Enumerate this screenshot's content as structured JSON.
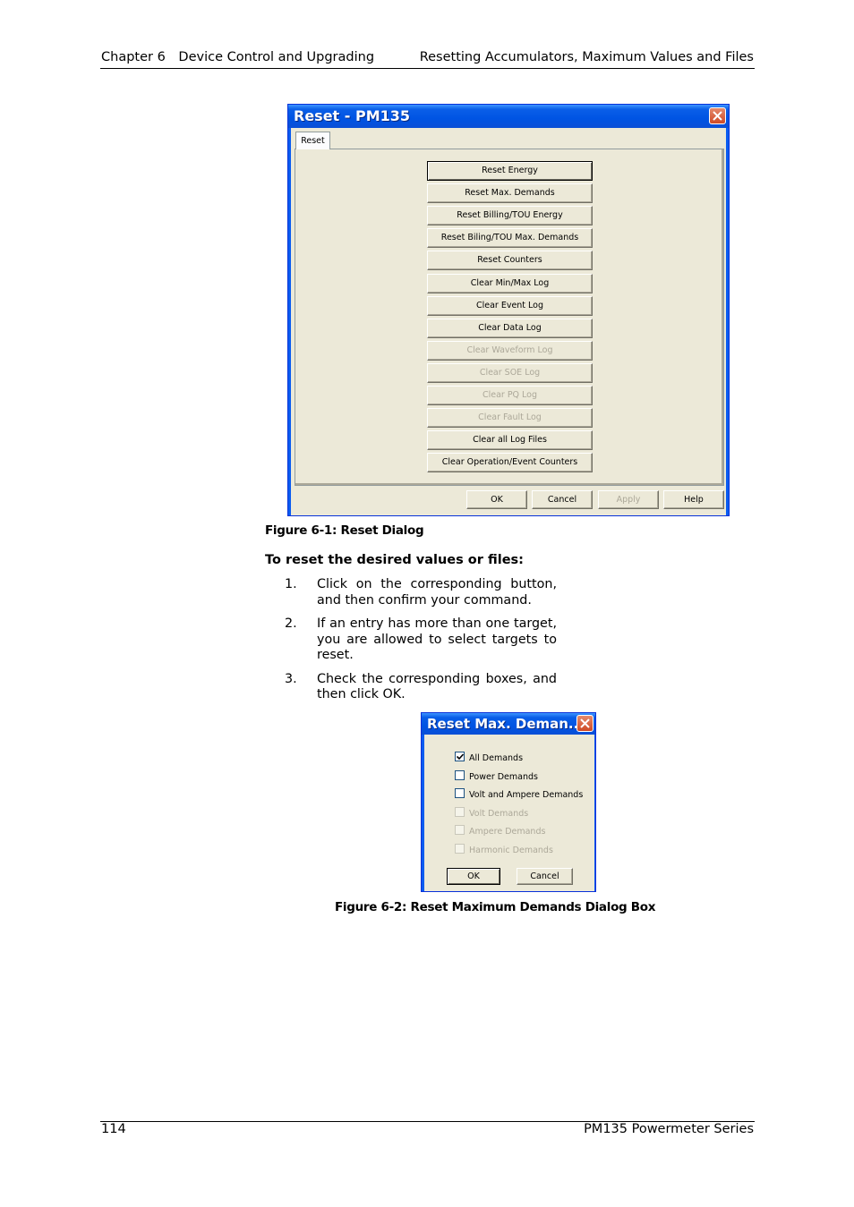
{
  "header": {
    "chapter": "Chapter 6",
    "chapter_title": "Device Control and Upgrading",
    "section_title": "Resetting Accumulators, Maximum Values and Files"
  },
  "figure1": {
    "window_title": "Reset - PM135",
    "tab_label": "Reset",
    "buttons": [
      {
        "label": "Reset Energy",
        "enabled": true,
        "default": true
      },
      {
        "label": "Reset Max. Demands",
        "enabled": true
      },
      {
        "label": "Reset Billing/TOU Energy",
        "enabled": true
      },
      {
        "label": "Reset Biling/TOU Max. Demands",
        "enabled": true
      },
      {
        "label": "Reset Counters",
        "enabled": true
      },
      {
        "label": "Clear Min/Max Log",
        "enabled": true
      },
      {
        "label": "Clear Event Log",
        "enabled": true
      },
      {
        "label": "Clear Data Log",
        "enabled": true
      },
      {
        "label": "Clear Waveform Log",
        "enabled": false
      },
      {
        "label": "Clear SOE Log",
        "enabled": false
      },
      {
        "label": "Clear PQ Log",
        "enabled": false
      },
      {
        "label": "Clear Fault Log",
        "enabled": false
      },
      {
        "label": "Clear all Log Files",
        "enabled": true
      },
      {
        "label": "Clear Operation/Event Counters",
        "enabled": true
      }
    ],
    "footer_buttons": {
      "ok": "OK",
      "cancel": "Cancel",
      "apply": "Apply",
      "help": "Help"
    },
    "caption": "Figure 6-1:  Reset Dialog"
  },
  "procedure": {
    "title": "To reset the desired values or files:",
    "steps": [
      {
        "num": "1.",
        "text": "Click on the corresponding button, and then confirm your command."
      },
      {
        "num": "2.",
        "text": "If an entry has more than one target, you are allowed to select targets to reset."
      },
      {
        "num": "3.",
        "text": "Check the corresponding boxes, and then click OK."
      }
    ]
  },
  "figure2": {
    "window_title": "Reset Max. Deman...",
    "checkboxes": [
      {
        "label": "All Demands",
        "checked": true,
        "enabled": true
      },
      {
        "label": "Power Demands",
        "checked": false,
        "enabled": true
      },
      {
        "label": "Volt and Ampere Demands",
        "checked": false,
        "enabled": true
      },
      {
        "label": "Volt Demands",
        "checked": false,
        "enabled": false
      },
      {
        "label": "Ampere Demands",
        "checked": false,
        "enabled": false
      },
      {
        "label": "Harmonic Demands",
        "checked": false,
        "enabled": false
      }
    ],
    "ok": "OK",
    "cancel": "Cancel",
    "caption": "Figure 6-2:  Reset Maximum Demands Dialog Box"
  },
  "footer": {
    "page_number": "114",
    "product": "PM135 Powermeter Series"
  }
}
